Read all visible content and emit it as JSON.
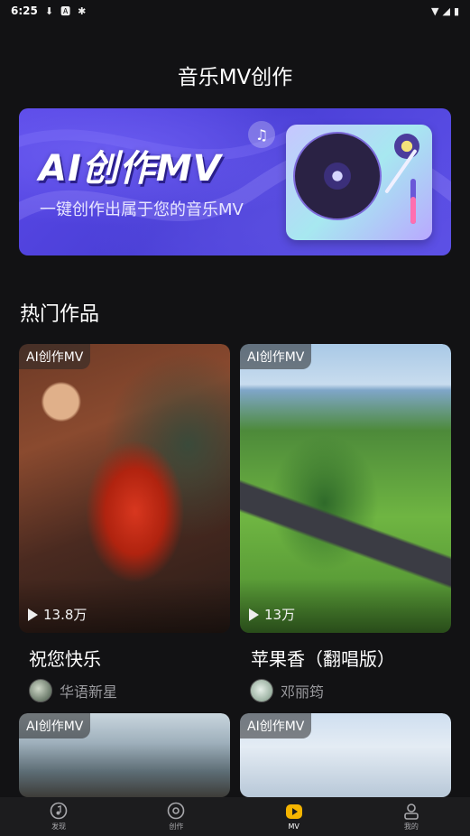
{
  "status_bar": {
    "time": "6:25"
  },
  "header": {
    "title": "音乐MV创作"
  },
  "banner": {
    "title": "AI创作MV",
    "subtitle": "一键创作出属于您的音乐MV"
  },
  "section": {
    "title": "热门作品"
  },
  "cards": [
    {
      "tag": "AI创作MV",
      "plays": "13.8万",
      "title": "祝您快乐",
      "author": "华语新星"
    },
    {
      "tag": "AI创作MV",
      "plays": "13万",
      "title": "苹果香（翻唱版）",
      "author": "邓丽筠"
    },
    {
      "tag": "AI创作MV"
    },
    {
      "tag": "AI创作MV"
    }
  ],
  "tabbar": {
    "items": [
      {
        "label": "发现",
        "icon": "music-note-icon"
      },
      {
        "label": "创作",
        "icon": "record-icon"
      },
      {
        "label": "MV",
        "icon": "play-icon"
      },
      {
        "label": "我的",
        "icon": "user-icon"
      }
    ],
    "active_index": 2
  },
  "colors": {
    "background": "#121214",
    "accent": "#f5b400",
    "banner": "#5a48e8"
  }
}
